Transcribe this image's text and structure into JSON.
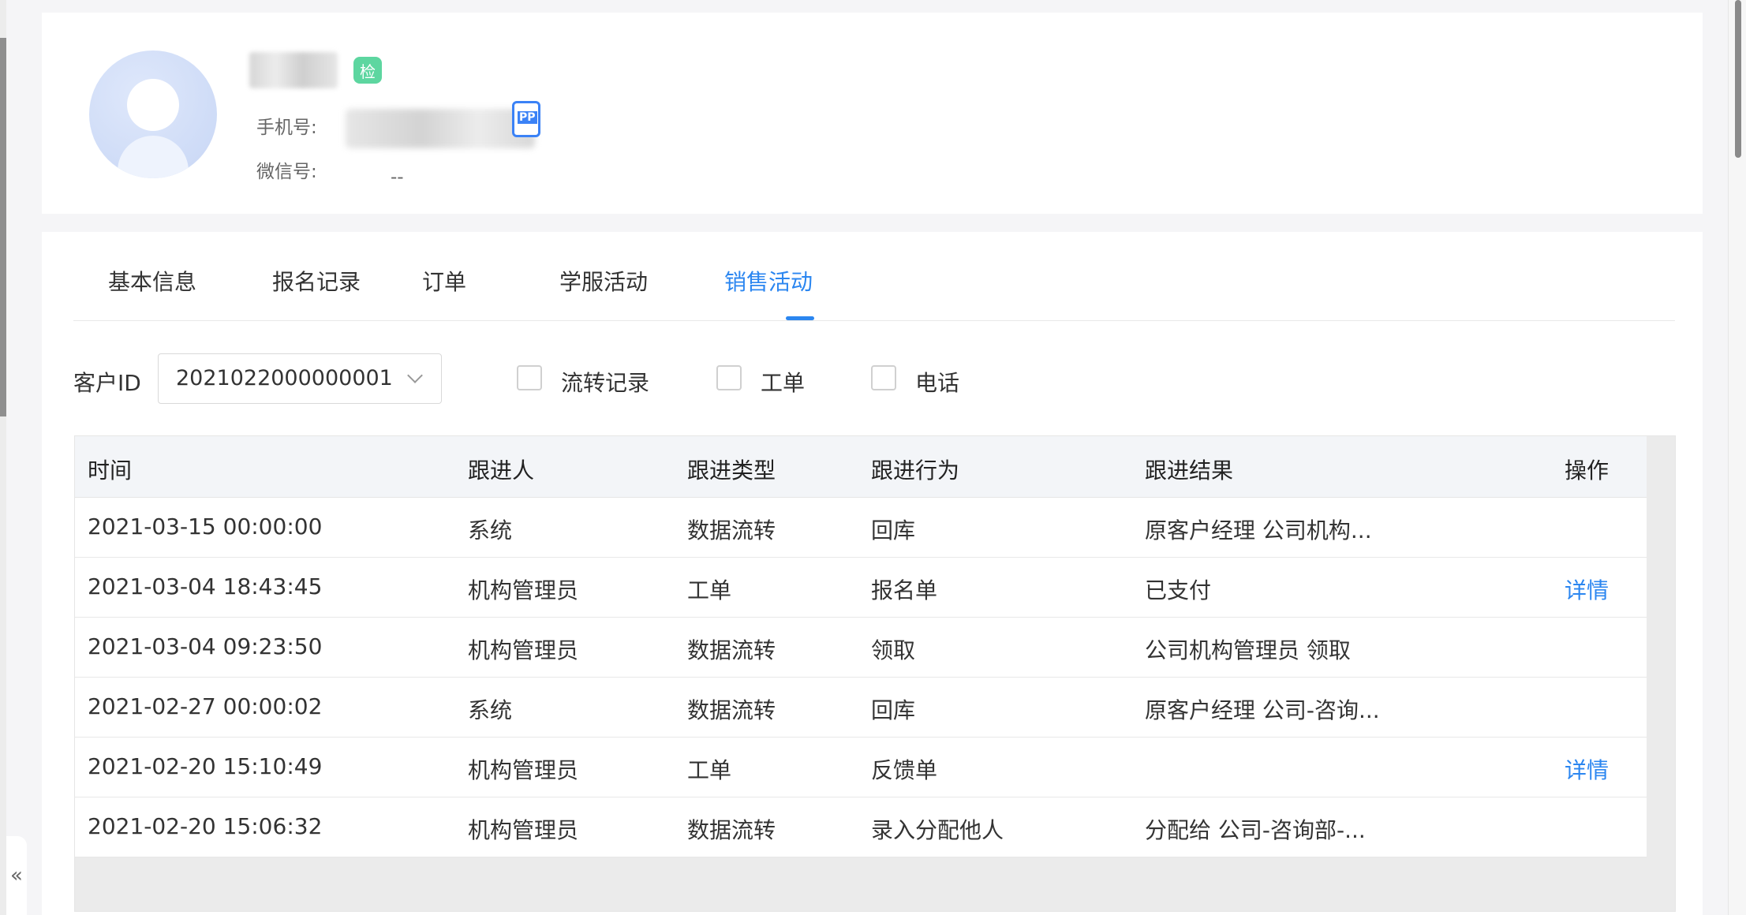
{
  "profile": {
    "verified_badge": "检",
    "phone_label": "手机号:",
    "app_badge": "PP",
    "wechat_label": "微信号:",
    "wechat_value": "--"
  },
  "tabs": [
    {
      "label": "基本信息",
      "active": false
    },
    {
      "label": "报名记录",
      "active": false
    },
    {
      "label": "订单",
      "active": false
    },
    {
      "label": "学服活动",
      "active": false
    },
    {
      "label": "销售活动",
      "active": true
    }
  ],
  "filters": {
    "customer_id_label": "客户ID",
    "customer_id_value": "2021022000000001",
    "checkboxes": [
      {
        "label": "流转记录",
        "checked": false
      },
      {
        "label": "工单",
        "checked": false
      },
      {
        "label": "电话",
        "checked": false
      }
    ]
  },
  "table": {
    "columns": [
      "时间",
      "跟进人",
      "跟进类型",
      "跟进行为",
      "跟进结果",
      "操作"
    ],
    "rows": [
      {
        "time": "2021-03-15 00:00:00",
        "person": "系统",
        "type": "数据流转",
        "action": "回库",
        "result": "原客户经理 公司机构...",
        "op": ""
      },
      {
        "time": "2021-03-04 18:43:45",
        "person": "机构管理员",
        "type": "工单",
        "action": "报名单",
        "result": "已支付",
        "op": "详情"
      },
      {
        "time": "2021-03-04 09:23:50",
        "person": "机构管理员",
        "type": "数据流转",
        "action": "领取",
        "result": "公司机构管理员 领取",
        "op": ""
      },
      {
        "time": "2021-02-27 00:00:02",
        "person": "系统",
        "type": "数据流转",
        "action": "回库",
        "result": "原客户经理 公司-咨询...",
        "op": ""
      },
      {
        "time": "2021-02-20 15:10:49",
        "person": "机构管理员",
        "type": "工单",
        "action": "反馈单",
        "result": "",
        "op": "详情"
      },
      {
        "time": "2021-02-20 15:06:32",
        "person": "机构管理员",
        "type": "数据流转",
        "action": "录入分配他人",
        "result": "分配给 公司-咨询部-...",
        "op": ""
      }
    ]
  },
  "sidebar_toggle": "«",
  "colors": {
    "accent": "#2b86f0",
    "badge": "#5dd6a0"
  }
}
